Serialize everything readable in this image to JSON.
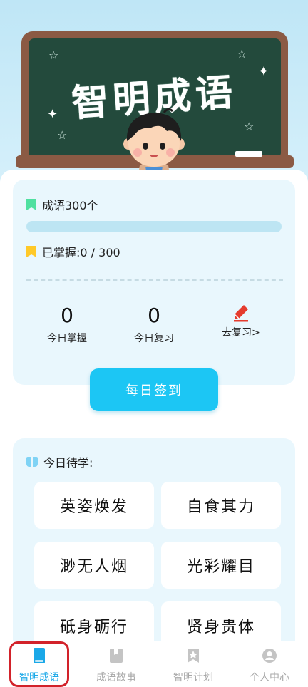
{
  "header": {
    "title": "智明成语"
  },
  "stats": {
    "total_label": "成语300个",
    "total_icon": "green-bookmark-icon",
    "mastered_label": "已掌握:0 / 300",
    "mastered_icon": "yellow-bookmark-icon",
    "progress_fraction": 0,
    "items": [
      {
        "value": "0",
        "label": "今日掌握"
      },
      {
        "value": "0",
        "label": "今日复习"
      },
      {
        "label": "去复习>",
        "icon": "pencil-icon"
      }
    ],
    "sign_button": "每日签到"
  },
  "today": {
    "title": "今日待学:",
    "icon": "book-icon",
    "idioms": [
      "英姿焕发",
      "自食其力",
      "渺无人烟",
      "光彩耀目",
      "砥身砺行",
      "贤身贵体"
    ]
  },
  "tabs": [
    {
      "label": "智明成语",
      "icon": "book-icon",
      "active": true
    },
    {
      "label": "成语故事",
      "icon": "bookmark-book-icon",
      "active": false
    },
    {
      "label": "智明计划",
      "icon": "star-badge-icon",
      "active": false
    },
    {
      "label": "个人中心",
      "icon": "user-icon",
      "active": false
    }
  ],
  "colors": {
    "accent": "#1cc6f4",
    "active_tab": "#1aa8e8",
    "board": "#234a3c",
    "frame": "#8b5a44",
    "card_bg": "#e9f7fd",
    "bookmark_green": "#4fe0a0",
    "bookmark_yellow": "#ffc928",
    "pencil_red": "#e53c2e",
    "highlight_red": "#d2222a"
  }
}
